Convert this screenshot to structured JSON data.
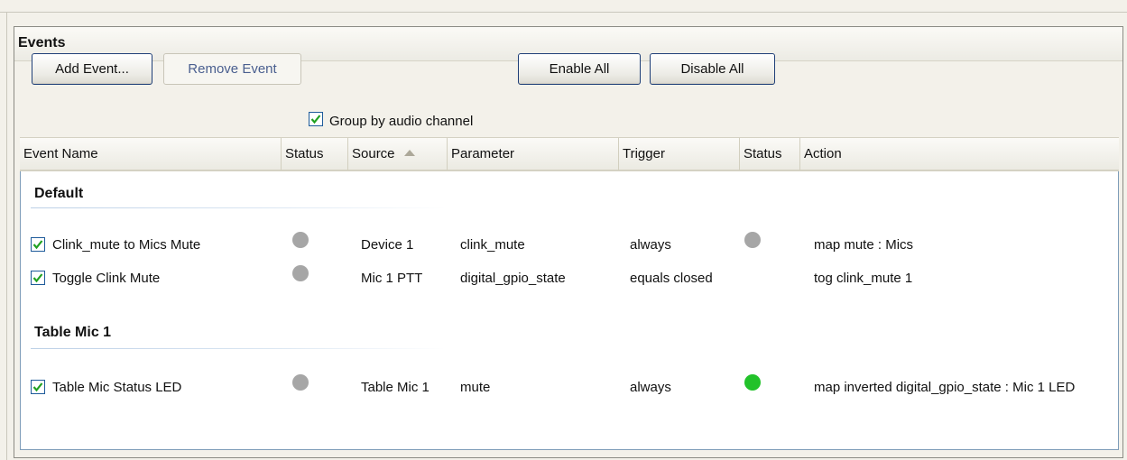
{
  "panel": {
    "title": "Events"
  },
  "toolbar": {
    "add_label": "Add Event...",
    "remove_label": "Remove Event",
    "group_label": "Group by audio channel",
    "group_checked": true,
    "enable_all_label": "Enable All",
    "disable_all_label": "Disable All"
  },
  "columns": {
    "event_name": "Event Name",
    "status": "Status",
    "source": "Source",
    "parameter": "Parameter",
    "trigger": "Trigger",
    "status2": "Status",
    "action": "Action"
  },
  "colors": {
    "status_gray": "#a6a6a6",
    "status_green": "#22c22a",
    "check_blue": "#1e5b9a",
    "checkmark": "#21a121"
  },
  "groups": [
    {
      "title": "Default",
      "rows": [
        {
          "name": "Clink_mute to Mics Mute",
          "source": "Device 1",
          "parameter": "clink_mute",
          "trigger": "always",
          "action": "map mute : Mics",
          "status": "gray",
          "status2": "gray"
        },
        {
          "name": "Toggle Clink Mute",
          "source": "Mic 1 PTT",
          "parameter": "digital_gpio_state",
          "trigger": "equals closed",
          "action": "tog clink_mute 1",
          "status": "gray",
          "status2": "none"
        }
      ]
    },
    {
      "title": "Table Mic 1",
      "rows": [
        {
          "name": "Table Mic Status LED",
          "source": "Table Mic 1",
          "parameter": "mute",
          "trigger": "always",
          "action": "map inverted digital_gpio_state : Mic 1 LED",
          "status": "gray",
          "status2": "green"
        }
      ]
    }
  ]
}
